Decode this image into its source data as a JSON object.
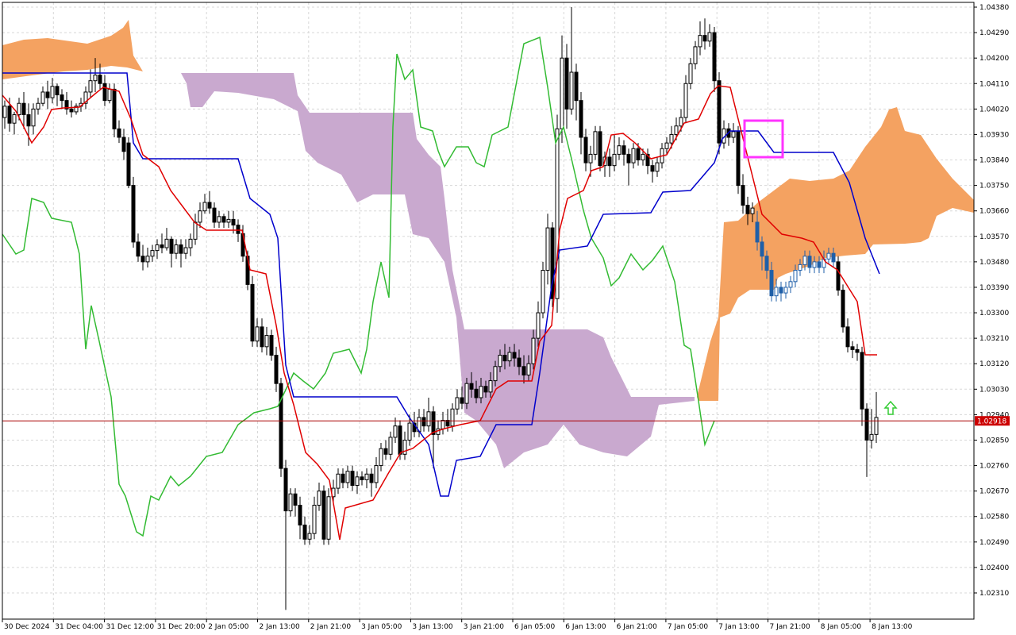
{
  "chart_data": {
    "type": "candlestick",
    "y_ticks": [
      "1.04380",
      "1.04290",
      "1.04200",
      "1.04110",
      "1.04020",
      "1.03930",
      "1.03840",
      "1.03750",
      "1.03660",
      "1.03570",
      "1.03480",
      "1.03390",
      "1.03300",
      "1.03210",
      "1.03120",
      "1.03030",
      "1.02940",
      "1.02850",
      "1.02760",
      "1.02670",
      "1.02580",
      "1.02490",
      "1.02400",
      "1.02310"
    ],
    "x_ticks": [
      "30 Dec 2024",
      "31 Dec 04:00",
      "31 Dec 12:00",
      "31 Dec 20:00",
      "2 Jan 05:00",
      "2 Jan 13:00",
      "2 Jan 21:00",
      "3 Jan 05:00",
      "3 Jan 13:00",
      "3 Jan 21:00",
      "6 Jan 05:00",
      "6 Jan 13:00",
      "6 Jan 21:00",
      "7 Jan 05:00",
      "7 Jan 13:00",
      "7 Jan 21:00",
      "8 Jan 05:00",
      "8 Jan 13:00"
    ],
    "current_price": "1.02918",
    "ylim": [
      1.0226,
      1.0442
    ],
    "colors": {
      "tenkan": "#e00000",
      "kijun": "#0000cc",
      "chikou": "#33bb33",
      "cloud_bull": "#f4a261",
      "cloud_bear": "#c9a9cf",
      "price_line": "#aa0000",
      "price_tag": "#cc0000",
      "grid": "#d8d8d8",
      "highlight": "#ff33ff",
      "arrow": "#33cc33"
    },
    "grid": true,
    "legend": "none"
  }
}
